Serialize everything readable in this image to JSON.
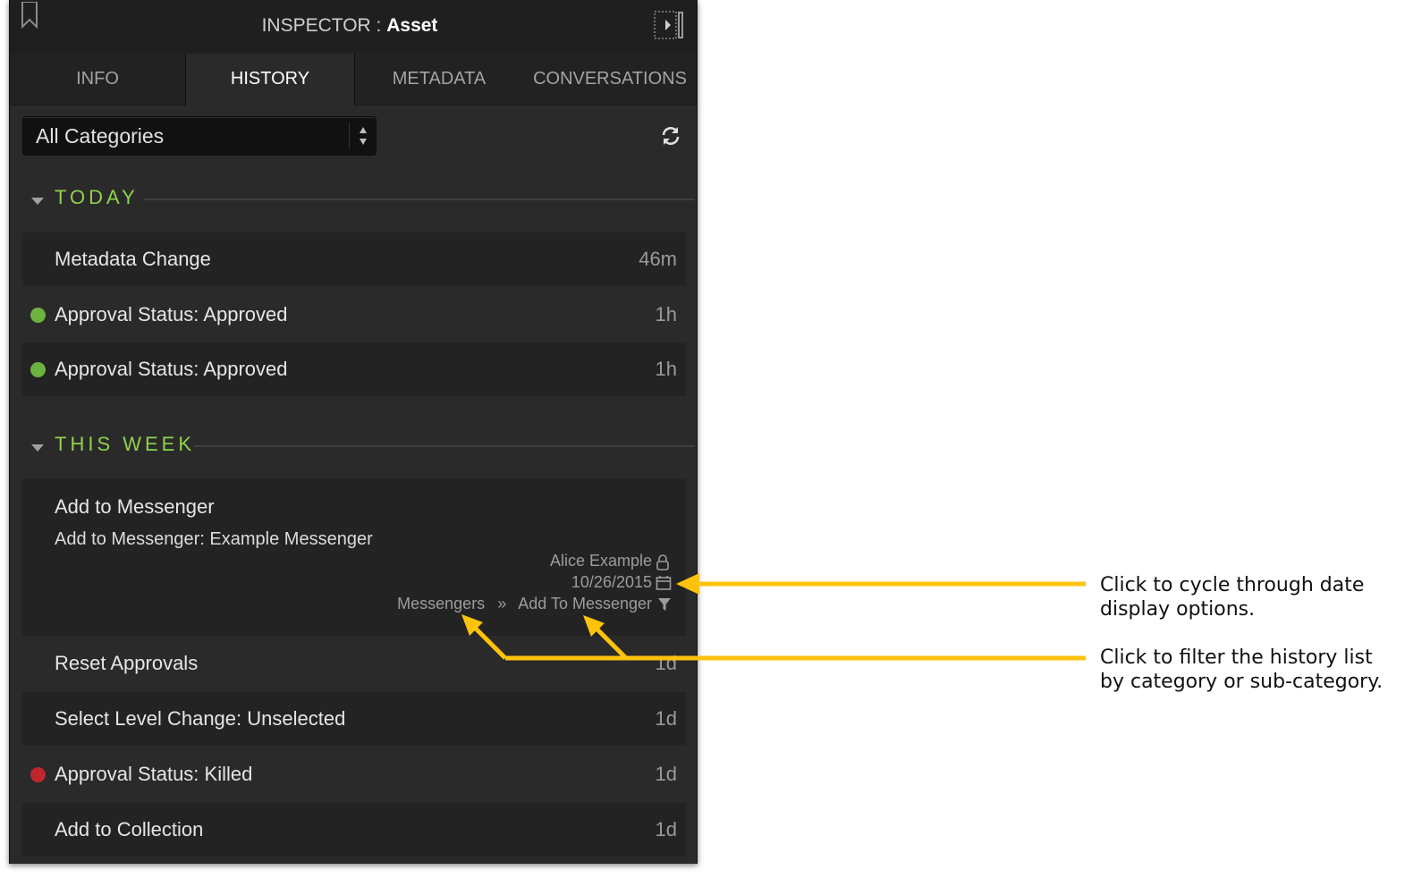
{
  "inspector": {
    "title_prefix": "INSPECTOR :",
    "title_name": "Asset",
    "bookmark_icon": "bookmark-icon",
    "collapse_icon": "collapse-panel-icon"
  },
  "tabs": [
    {
      "label": "INFO",
      "active": false
    },
    {
      "label": "HISTORY",
      "active": true
    },
    {
      "label": "METADATA",
      "active": false
    },
    {
      "label": "CONVERSATIONS",
      "active": false
    }
  ],
  "filter": {
    "selected": "All Categories",
    "refresh_icon": "refresh-icon"
  },
  "sections": [
    {
      "label": "TODAY",
      "items": [
        {
          "label": "Metadata Change",
          "time": "46m",
          "status": null
        },
        {
          "label": "Approval Status: Approved",
          "time": "1h",
          "status": "approved"
        },
        {
          "label": "Approval Status: Approved",
          "time": "1h",
          "status": "approved"
        }
      ]
    },
    {
      "label": "THIS WEEK",
      "expanded_item": {
        "title": "Add to Messenger",
        "detail": "Add to Messenger: Example Messenger",
        "user": "Alice Example",
        "date": "10/26/2015",
        "category": "Messengers",
        "separator": "»",
        "subcategory": "Add To Messenger"
      },
      "items": [
        {
          "label": "Reset Approvals",
          "time": "1d",
          "status": null
        },
        {
          "label": "Select Level Change: Unselected",
          "time": "1d",
          "status": null
        },
        {
          "label": "Approval Status: Killed",
          "time": "1d",
          "status": "killed"
        },
        {
          "label": "Add to Collection",
          "time": "1d",
          "status": null
        }
      ]
    }
  ],
  "callouts": {
    "date": "Click to cycle through date display options.",
    "filter": "Click to filter the history list by category or sub-category."
  },
  "colors": {
    "panel_bg": "#2a2a2a",
    "section_label": "#8fd24b",
    "approved": "#6cb33f",
    "killed": "#c0272d",
    "callout_arrow": "#fcc30a"
  }
}
